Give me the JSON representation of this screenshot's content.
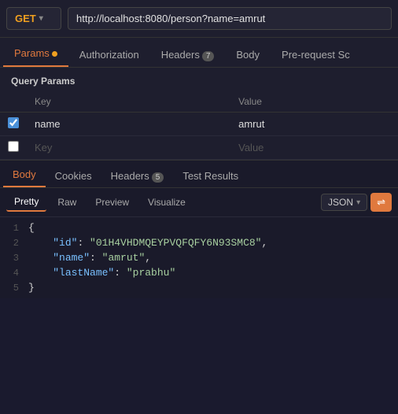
{
  "topbar": {
    "method": "GET",
    "url": "http://localhost:8080/person?name=amrut",
    "chevron": "▾"
  },
  "tabs": [
    {
      "id": "params",
      "label": "Params",
      "active": true,
      "dot": true
    },
    {
      "id": "authorization",
      "label": "Authorization",
      "active": false
    },
    {
      "id": "headers",
      "label": "Headers",
      "badge": "7",
      "active": false
    },
    {
      "id": "body",
      "label": "Body",
      "active": false
    },
    {
      "id": "prerequest",
      "label": "Pre-request Sc",
      "active": false
    }
  ],
  "queryParams": {
    "title": "Query Params",
    "columns": [
      "Key",
      "Value"
    ],
    "rows": [
      {
        "checked": true,
        "key": "name",
        "value": "amrut"
      },
      {
        "checked": false,
        "key": "",
        "value": ""
      }
    ],
    "placeholderKey": "Key",
    "placeholderValue": "Value"
  },
  "bottomTabs": [
    {
      "id": "body",
      "label": "Body",
      "active": true
    },
    {
      "id": "cookies",
      "label": "Cookies",
      "active": false
    },
    {
      "id": "headers",
      "label": "Headers",
      "badge": "5",
      "active": false
    },
    {
      "id": "testresults",
      "label": "Test Results",
      "active": false
    }
  ],
  "formatBar": {
    "buttons": [
      "Pretty",
      "Raw",
      "Preview",
      "Visualize"
    ],
    "activeButton": "Pretty",
    "dropdownLabel": "JSON",
    "wrapIcon": "≡"
  },
  "jsonOutput": {
    "lines": [
      {
        "num": 1,
        "content": "{",
        "type": "brace"
      },
      {
        "num": 2,
        "key": "id",
        "value": "\"01H4VHDMQEYPVQFQFY6N93SMC8\"",
        "comma": true
      },
      {
        "num": 3,
        "key": "name",
        "value": "\"amrut\"",
        "comma": true
      },
      {
        "num": 4,
        "key": "lastName",
        "value": "\"prabhu\"",
        "comma": false
      },
      {
        "num": 5,
        "content": "}",
        "type": "brace"
      }
    ]
  }
}
